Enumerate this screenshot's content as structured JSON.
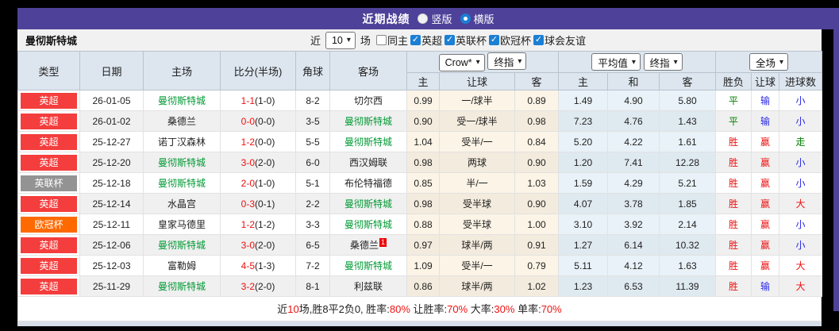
{
  "colors": {
    "red": "#ee1111",
    "green": "#008000",
    "blue": "#2626e8",
    "team_green": "#009933",
    "plain_text": "#222222",
    "epl": "#f43d3d",
    "league_cup": "#939393",
    "ucl": "#ff6a00",
    "accent_blue": "#1b7fd4",
    "header_purple": "#4e4199"
  },
  "title_bar": {
    "title": "近期战绩",
    "radios": [
      {
        "label": "竖版",
        "checked": false
      },
      {
        "label": "横版",
        "checked": true
      }
    ]
  },
  "filter_bar": {
    "team": "曼彻斯特城",
    "near_label": "近",
    "near_value": "10",
    "unit_label": "场",
    "same_home_label": "同主",
    "leagues": [
      "英超",
      "英联杯",
      "欧冠杯",
      "球会友谊"
    ]
  },
  "selectors": {
    "crow": "Crow*",
    "crow_time": "终指",
    "europe": "平均值",
    "europe_time": "终指",
    "scope": "全场"
  },
  "table": {
    "left_headers": [
      "类型",
      "日期",
      "主场",
      "比分(半场)",
      "角球",
      "客场"
    ],
    "sub_headers": [
      "主",
      "让球",
      "客",
      "主",
      "和",
      "客",
      "胜负",
      "让球",
      "进球数"
    ],
    "rows": [
      {
        "type": "英超",
        "type_key": "epl",
        "date": "26-01-05",
        "home": "曼彻斯特城",
        "home_is_team": true,
        "score": "1-1",
        "half": "(1-0)",
        "corner": "8-2",
        "away": "切尔西",
        "away_is_team": false,
        "red_card": "",
        "crow_home": "0.99",
        "crow_line": "一/球半",
        "crow_away": "0.89",
        "avg_home": "1.49",
        "avg_draw": "4.90",
        "avg_away": "5.80",
        "outcome": "平",
        "outcome_c": "green",
        "hres": "输",
        "hres_c": "blue",
        "gres": "小",
        "gres_c": "blue"
      },
      {
        "type": "英超",
        "type_key": "epl",
        "date": "26-01-02",
        "home": "桑德兰",
        "home_is_team": false,
        "score": "0-0",
        "half": "(0-0)",
        "corner": "3-5",
        "away": "曼彻斯特城",
        "away_is_team": true,
        "red_card": "",
        "crow_home": "0.90",
        "crow_line": "受一/球半",
        "crow_away": "0.98",
        "avg_home": "7.23",
        "avg_draw": "4.76",
        "avg_away": "1.43",
        "outcome": "平",
        "outcome_c": "green",
        "hres": "输",
        "hres_c": "blue",
        "gres": "小",
        "gres_c": "blue"
      },
      {
        "type": "英超",
        "type_key": "epl",
        "date": "25-12-27",
        "home": "诺丁汉森林",
        "home_is_team": false,
        "score": "1-2",
        "half": "(0-0)",
        "corner": "5-5",
        "away": "曼彻斯特城",
        "away_is_team": true,
        "red_card": "",
        "crow_home": "1.04",
        "crow_line": "受半/一",
        "crow_away": "0.84",
        "avg_home": "5.20",
        "avg_draw": "4.22",
        "avg_away": "1.61",
        "outcome": "胜",
        "outcome_c": "red",
        "hres": "赢",
        "hres_c": "red",
        "gres": "走",
        "gres_c": "green"
      },
      {
        "type": "英超",
        "type_key": "epl",
        "date": "25-12-20",
        "home": "曼彻斯特城",
        "home_is_team": true,
        "score": "3-0",
        "half": "(2-0)",
        "corner": "6-0",
        "away": "西汉姆联",
        "away_is_team": false,
        "red_card": "",
        "crow_home": "0.98",
        "crow_line": "两球",
        "crow_away": "0.90",
        "avg_home": "1.20",
        "avg_draw": "7.41",
        "avg_away": "12.28",
        "outcome": "胜",
        "outcome_c": "red",
        "hres": "赢",
        "hres_c": "red",
        "gres": "小",
        "gres_c": "blue"
      },
      {
        "type": "英联杯",
        "type_key": "league_cup",
        "date": "25-12-18",
        "home": "曼彻斯特城",
        "home_is_team": true,
        "score": "2-0",
        "half": "(1-0)",
        "corner": "5-1",
        "away": "布伦特福德",
        "away_is_team": false,
        "red_card": "",
        "crow_home": "0.85",
        "crow_line": "半/一",
        "crow_away": "1.03",
        "avg_home": "1.59",
        "avg_draw": "4.29",
        "avg_away": "5.21",
        "outcome": "胜",
        "outcome_c": "red",
        "hres": "赢",
        "hres_c": "red",
        "gres": "小",
        "gres_c": "blue"
      },
      {
        "type": "英超",
        "type_key": "epl",
        "date": "25-12-14",
        "home": "水晶宫",
        "home_is_team": false,
        "score": "0-3",
        "half": "(0-1)",
        "corner": "2-2",
        "away": "曼彻斯特城",
        "away_is_team": true,
        "red_card": "",
        "crow_home": "0.98",
        "crow_line": "受半球",
        "crow_away": "0.90",
        "avg_home": "4.07",
        "avg_draw": "3.78",
        "avg_away": "1.85",
        "outcome": "胜",
        "outcome_c": "red",
        "hres": "赢",
        "hres_c": "red",
        "gres": "大",
        "gres_c": "red"
      },
      {
        "type": "欧冠杯",
        "type_key": "ucl",
        "date": "25-12-11",
        "home": "皇家马德里",
        "home_is_team": false,
        "score": "1-2",
        "half": "(1-2)",
        "corner": "3-3",
        "away": "曼彻斯特城",
        "away_is_team": true,
        "red_card": "",
        "crow_home": "0.88",
        "crow_line": "受半球",
        "crow_away": "1.00",
        "avg_home": "3.10",
        "avg_draw": "3.92",
        "avg_away": "2.14",
        "outcome": "胜",
        "outcome_c": "red",
        "hres": "赢",
        "hres_c": "red",
        "gres": "小",
        "gres_c": "blue"
      },
      {
        "type": "英超",
        "type_key": "epl",
        "date": "25-12-06",
        "home": "曼彻斯特城",
        "home_is_team": true,
        "score": "3-0",
        "half": "(2-0)",
        "corner": "6-5",
        "away": "桑德兰",
        "away_is_team": false,
        "red_card": "1",
        "crow_home": "0.97",
        "crow_line": "球半/两",
        "crow_away": "0.91",
        "avg_home": "1.27",
        "avg_draw": "6.14",
        "avg_away": "10.32",
        "outcome": "胜",
        "outcome_c": "red",
        "hres": "赢",
        "hres_c": "red",
        "gres": "小",
        "gres_c": "blue"
      },
      {
        "type": "英超",
        "type_key": "epl",
        "date": "25-12-03",
        "home": "富勒姆",
        "home_is_team": false,
        "score": "4-5",
        "half": "(1-3)",
        "corner": "7-2",
        "away": "曼彻斯特城",
        "away_is_team": true,
        "red_card": "",
        "crow_home": "1.09",
        "crow_line": "受半/一",
        "crow_away": "0.79",
        "avg_home": "5.11",
        "avg_draw": "4.12",
        "avg_away": "1.63",
        "outcome": "胜",
        "outcome_c": "red",
        "hres": "赢",
        "hres_c": "red",
        "gres": "大",
        "gres_c": "red"
      },
      {
        "type": "英超",
        "type_key": "epl",
        "date": "25-11-29",
        "home": "曼彻斯特城",
        "home_is_team": true,
        "score": "3-2",
        "half": "(2-0)",
        "corner": "8-1",
        "away": "利兹联",
        "away_is_team": false,
        "red_card": "",
        "crow_home": "0.86",
        "crow_line": "球半/两",
        "crow_away": "1.02",
        "avg_home": "1.23",
        "avg_draw": "6.53",
        "avg_away": "11.39",
        "outcome": "胜",
        "outcome_c": "red",
        "hres": "输",
        "hres_c": "blue",
        "gres": "大",
        "gres_c": "red"
      }
    ]
  },
  "summary": {
    "parts": [
      {
        "text": "近",
        "color": "plain"
      },
      {
        "text": "10",
        "color": "red"
      },
      {
        "text": "场,胜8平2负0, 胜率:",
        "color": "plain"
      },
      {
        "text": "80%",
        "color": "red"
      },
      {
        "text": " 让胜率:",
        "color": "plain"
      },
      {
        "text": "70%",
        "color": "red"
      },
      {
        "text": " 大率:",
        "color": "plain"
      },
      {
        "text": "30%",
        "color": "red"
      },
      {
        "text": " 单率:",
        "color": "plain"
      },
      {
        "text": "70%",
        "color": "red"
      }
    ]
  }
}
